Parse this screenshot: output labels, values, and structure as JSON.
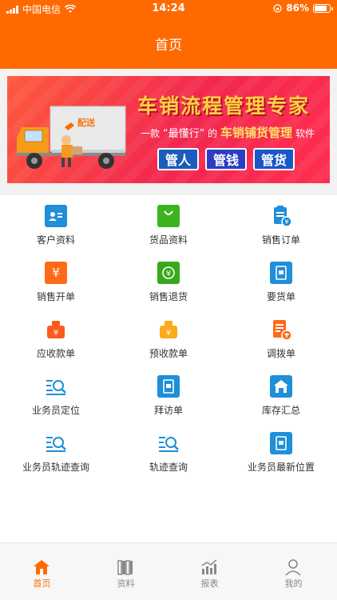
{
  "status": {
    "carrier": "中国电信",
    "time": "14:24",
    "battery": "86%",
    "battery_level": 0.86
  },
  "nav": {
    "title": "首页"
  },
  "banner": {
    "title": "车销流程管理专家",
    "sub_prefix": "一款",
    "sub_quote": "“最懂行”",
    "sub_mid": "的",
    "sub_highlight": "车销铺货管理",
    "sub_suffix": "软件",
    "tags": [
      "管人",
      "管钱",
      "管货"
    ],
    "truck_brand": "配送"
  },
  "grid": [
    {
      "label": "客户资料",
      "icon": "customer-card-icon",
      "color": "#1e8fd8"
    },
    {
      "label": "货品资料",
      "icon": "shopping-bag-icon",
      "color": "#3cb41e"
    },
    {
      "label": "销售订单",
      "icon": "sales-order-icon",
      "color": "#1e8fd8"
    },
    {
      "label": "销售开单",
      "icon": "yuan-receipt-icon",
      "color": "#ff6a1a"
    },
    {
      "label": "销售退货",
      "icon": "return-yuan-icon",
      "color": "#38a81b"
    },
    {
      "label": "要货单",
      "icon": "request-form-icon",
      "color": "#1e8fd8"
    },
    {
      "label": "应收款单",
      "icon": "receivable-box-icon",
      "color": "#ff5a1a"
    },
    {
      "label": "预收款单",
      "icon": "prepaid-box-icon",
      "color": "#ffaa1a"
    },
    {
      "label": "调拨单",
      "icon": "transfer-doc-icon",
      "color": "#ff6a1a"
    },
    {
      "label": "业务员定位",
      "icon": "locate-search-icon",
      "color": "#1e8fd8"
    },
    {
      "label": "拜访单",
      "icon": "visit-form-icon",
      "color": "#1e8fd8"
    },
    {
      "label": "库存汇总",
      "icon": "warehouse-icon",
      "color": "#1e8fd8"
    },
    {
      "label": "业务员轨迹查询",
      "icon": "track-search-icon",
      "color": "#1e8fd8"
    },
    {
      "label": "轨迹查询",
      "icon": "route-search-icon",
      "color": "#1e8fd8"
    },
    {
      "label": "业务员最新位置",
      "icon": "latest-position-icon",
      "color": "#1e8fd8"
    }
  ],
  "tabs": [
    {
      "label": "首页",
      "icon": "home-icon",
      "active": true
    },
    {
      "label": "资料",
      "icon": "books-icon",
      "active": false
    },
    {
      "label": "报表",
      "icon": "chart-icon",
      "active": false
    },
    {
      "label": "我的",
      "icon": "user-icon",
      "active": false
    }
  ],
  "colors": {
    "brand": "#ff6a00",
    "tab_inactive": "#888888"
  }
}
